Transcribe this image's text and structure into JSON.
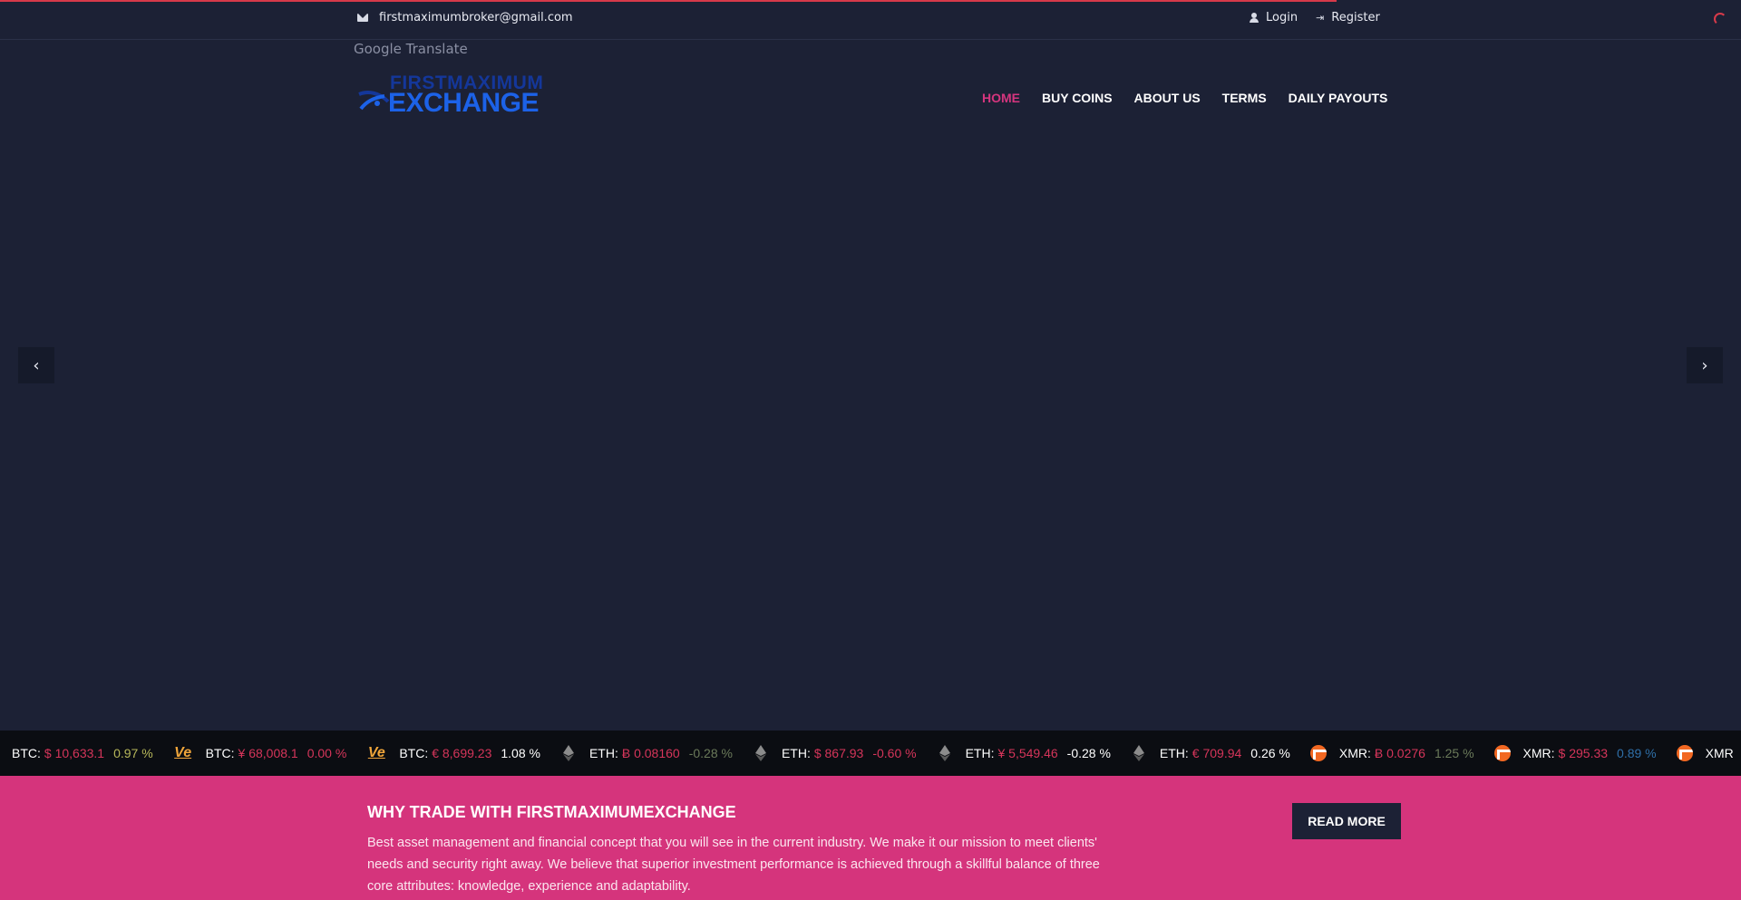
{
  "topbar": {
    "email": "firstmaximumbroker@gmail.com",
    "login_label": "Login",
    "register_label": "Register"
  },
  "translate_label": "Google Translate",
  "logo": {
    "top_text": "FIRSTMAXIMUM",
    "main_text": "EXCHANGE"
  },
  "nav": {
    "items": [
      {
        "label": "HOME",
        "active": true
      },
      {
        "label": "BUY COINS",
        "active": false
      },
      {
        "label": "ABOUT US",
        "active": false
      },
      {
        "label": "TERMS",
        "active": false
      },
      {
        "label": "DAILY PAYOUTS",
        "active": false
      }
    ]
  },
  "slider": {
    "prev_icon": "chevron-left-icon",
    "next_icon": "chevron-right-icon"
  },
  "ticker": {
    "items": [
      {
        "coin": "",
        "symbol": "BTC:",
        "price": "$ 10,633.1",
        "change": "0.97 %",
        "change_color": "#b7b75a"
      },
      {
        "coin": "ve",
        "symbol": "BTC:",
        "price": "¥ 68,008.1",
        "change": "0.00 %",
        "change_color": "#d5355a"
      },
      {
        "coin": "ve",
        "symbol": "BTC:",
        "price": "€ 8,699.23",
        "change": "1.08 %",
        "change_color": "#ffffff"
      },
      {
        "coin": "eth",
        "symbol": "ETH:",
        "price": "Ƀ 0.08160",
        "change": "-0.28 %",
        "change_color": "#6b7a5a"
      },
      {
        "coin": "eth",
        "symbol": "ETH:",
        "price": "$ 867.93",
        "change": "-0.60 %",
        "change_color": "#d5355a"
      },
      {
        "coin": "eth",
        "symbol": "ETH:",
        "price": "¥ 5,549.46",
        "change": "-0.28 %",
        "change_color": "#ffffff"
      },
      {
        "coin": "eth",
        "symbol": "ETH:",
        "price": "€ 709.94",
        "change": "0.26 %",
        "change_color": "#ffffff"
      },
      {
        "coin": "xmr",
        "symbol": "XMR:",
        "price": "Ƀ 0.0276",
        "change": "1.25 %",
        "change_color": "#6b7a5a"
      },
      {
        "coin": "xmr",
        "symbol": "XMR:",
        "price": "$ 295.33",
        "change": "0.89 %",
        "change_color": "#2f6fa8"
      },
      {
        "coin": "xmr",
        "symbol": "XMR",
        "price": "",
        "change": "",
        "change_color": "#ffffff"
      }
    ]
  },
  "promo": {
    "title": "WHY TRADE WITH FIRSTMAXIMUMEXCHANGE",
    "body": "Best asset management and financial concept that you will see in the current industry. We make it our mission to meet clients' needs and security right away. We believe that superior investment performance is achieved through a skillful balance of three core attributes: knowledge, experience and adaptability.",
    "button_label": "READ MORE"
  },
  "colors": {
    "background": "#1c2135",
    "accent_pink": "#d5347c",
    "loader_red": "#d63a4a",
    "logo_blue": "#1c62e8"
  }
}
